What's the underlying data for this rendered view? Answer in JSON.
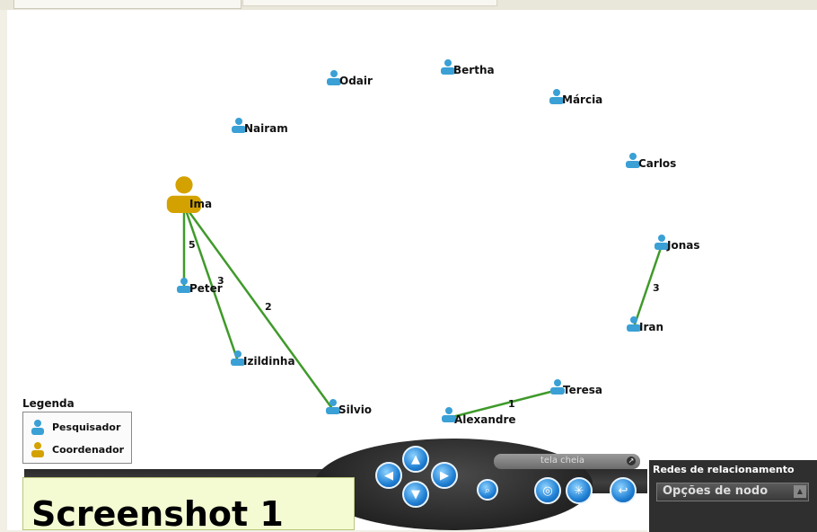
{
  "legend": {
    "title": "Legenda",
    "items": [
      {
        "label": "Pesquisador",
        "icon": "researcher-person-icon",
        "color": "#3aa0d5"
      },
      {
        "label": "Coordenador",
        "icon": "coordinator-person-icon",
        "color": "#d4a200"
      }
    ]
  },
  "graph": {
    "nodes": [
      {
        "id": "ima",
        "label": "Ima",
        "role": "coordenador"
      },
      {
        "id": "odair",
        "label": "Odair",
        "role": "pesquisador"
      },
      {
        "id": "bertha",
        "label": "Bertha",
        "role": "pesquisador"
      },
      {
        "id": "marcia",
        "label": "Márcia",
        "role": "pesquisador"
      },
      {
        "id": "nairam",
        "label": "Nairam",
        "role": "pesquisador"
      },
      {
        "id": "carlos",
        "label": "Carlos",
        "role": "pesquisador"
      },
      {
        "id": "jonas",
        "label": "Jonas",
        "role": "pesquisador"
      },
      {
        "id": "iran",
        "label": "Iran",
        "role": "pesquisador"
      },
      {
        "id": "peter",
        "label": "Peter",
        "role": "pesquisador"
      },
      {
        "id": "izildinha",
        "label": "Izildinha",
        "role": "pesquisador"
      },
      {
        "id": "silvio",
        "label": "Silvio",
        "role": "pesquisador"
      },
      {
        "id": "teresa",
        "label": "Teresa",
        "role": "pesquisador"
      },
      {
        "id": "alexandre",
        "label": "Alexandre",
        "role": "pesquisador"
      }
    ],
    "edges": [
      {
        "from": "ima",
        "to": "peter",
        "weight": "5"
      },
      {
        "from": "ima",
        "to": "izildinha",
        "weight": "3"
      },
      {
        "from": "ima",
        "to": "silvio",
        "weight": "2"
      },
      {
        "from": "jonas",
        "to": "iran",
        "weight": "3"
      },
      {
        "from": "teresa",
        "to": "alexandre",
        "weight": "1"
      }
    ],
    "edge_color": "#3f9a2a"
  },
  "toolbar": {
    "fullscreen_label": "tela cheia",
    "panel_title": "Redes de relacionamento",
    "select_value": "Opções de nodo"
  },
  "callout": {
    "text": "Screenshot 1"
  }
}
